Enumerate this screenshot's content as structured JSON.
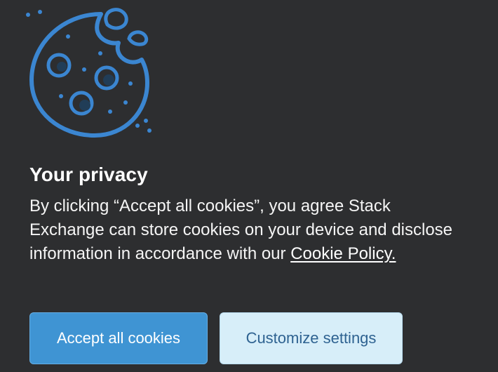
{
  "banner": {
    "icon": "cookie-icon",
    "title": "Your privacy",
    "body_prefix": "By clicking “Accept all cookies”, you agree Stack Exchange can store cookies on your device and disclose information in accordance with our ",
    "policy_link": "Cookie Policy.",
    "accept_label": "Accept all cookies",
    "customize_label": "Customize settings"
  },
  "colors": {
    "background": "#2d2e30",
    "accent": "#3f94d3",
    "icon_blue": "#3b86d1",
    "secondary_button": "#d7eef9",
    "secondary_text": "#2e6291"
  }
}
